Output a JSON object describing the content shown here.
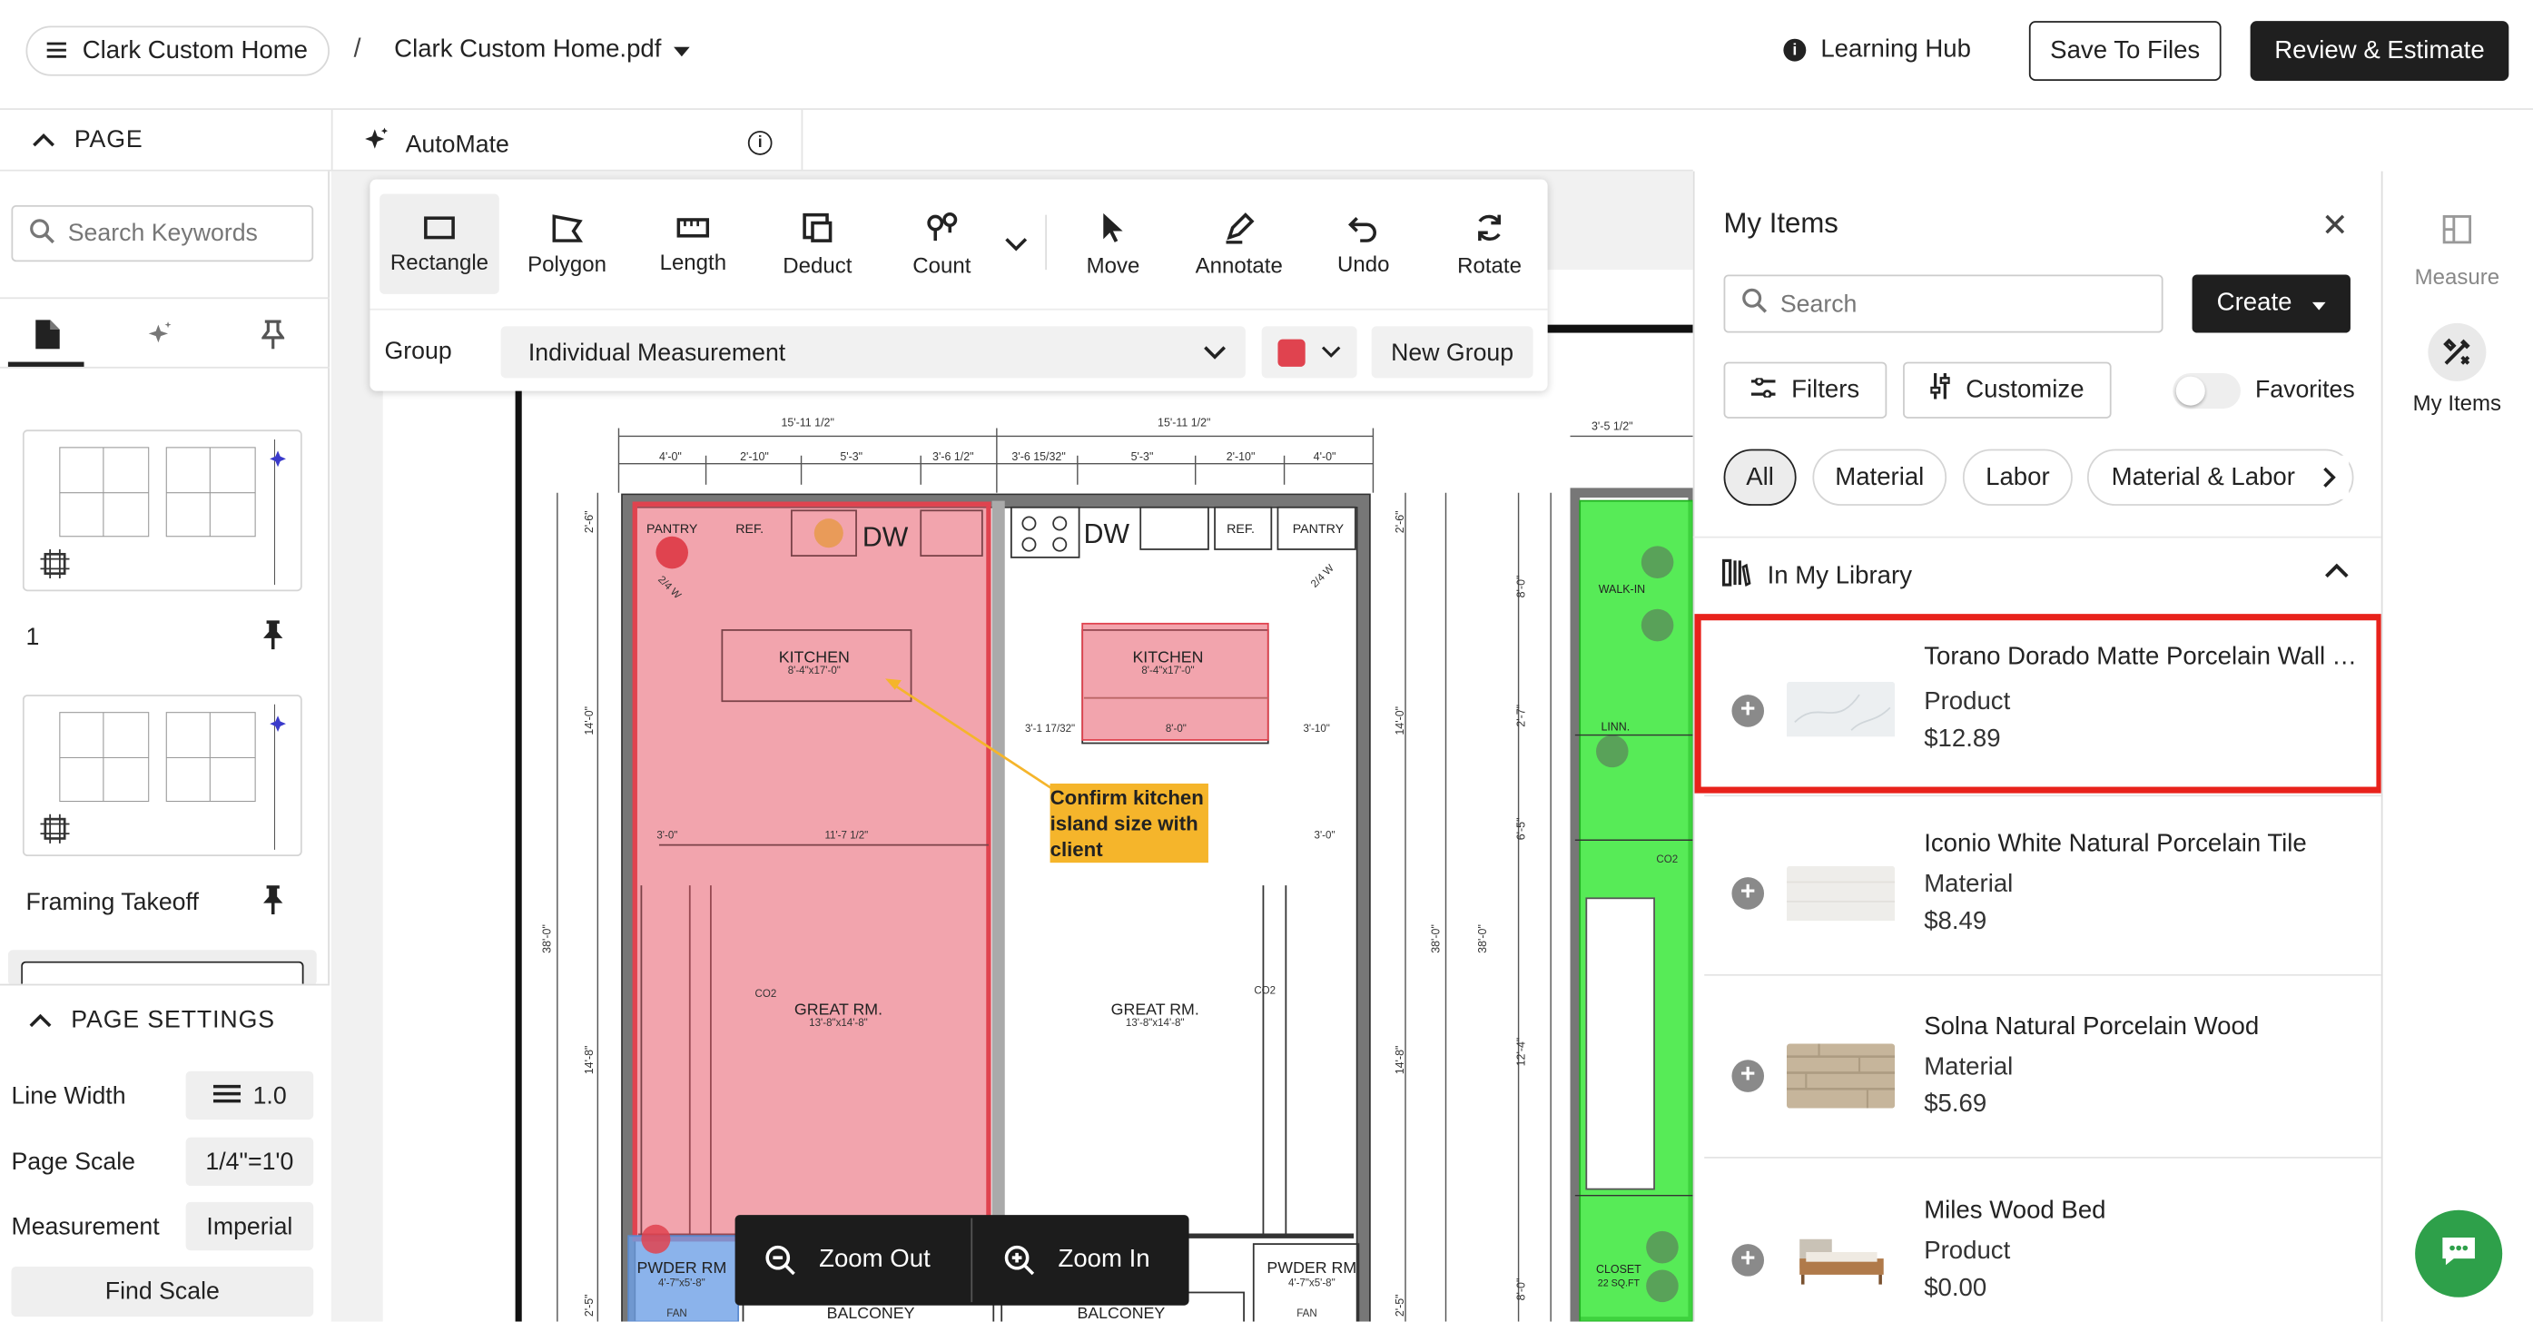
{
  "header": {
    "project_name": "Clark Custom Home",
    "separator": "/",
    "file_name": "Clark Custom Home.pdf",
    "learning_hub": "Learning Hub",
    "save_to_files": "Save To Files",
    "review_estimate": "Review & Estimate"
  },
  "subbar": {
    "page_label": "PAGE",
    "automate_label": "AutoMate"
  },
  "left_panel": {
    "search_placeholder": "Search Keywords",
    "pages": [
      {
        "label": "1"
      },
      {
        "label": "Framing Takeoff"
      }
    ],
    "settings": {
      "title": "PAGE SETTINGS",
      "line_width_label": "Line Width",
      "line_width_value": "1.0",
      "page_scale_label": "Page Scale",
      "page_scale_value": "1/4\"=1'0",
      "measurement_label": "Measurement",
      "measurement_value": "Imperial",
      "find_scale": "Find Scale"
    }
  },
  "toolbar": {
    "tools": [
      "Rectangle",
      "Polygon",
      "Length",
      "Deduct",
      "Count",
      "Move",
      "Annotate",
      "Undo",
      "Rotate"
    ],
    "group_label": "Group",
    "group_value": "Individual Measurement",
    "group_color": "#e0434f",
    "new_group": "New Group"
  },
  "blueprint": {
    "dims_top_left": [
      "15'-11 1/2\"",
      "4'-0\"",
      "2'-10\"",
      "5'-3\"",
      "3'-6 1/2\""
    ],
    "dims_top_right": [
      "15'-11 1/2\"",
      "3'-6 15/32\"",
      "5'-3\"",
      "2'-10\"",
      "4'-0\""
    ],
    "dim_far_right": "3'-5 1/2\"",
    "left_labels": [
      "2'-6\"",
      "14'-0\"",
      "38'-0\"",
      "14'-8\"",
      "2'-5\""
    ],
    "labels": {
      "pantry_l": "PANTRY",
      "ref_l": "REF.",
      "dw_l": "DW",
      "dw_r": "DW",
      "ref_r": "REF.",
      "pantry_r": "PANTRY",
      "kitchen_l": "KITCHEN",
      "kitchen_l_dim": "8'-4\"x17'-0\"",
      "kitchen_r": "KITCHEN",
      "kitchen_r_dim": "8'-4\"x17'-0\"",
      "dim_3_0a": "3'-0\"",
      "dim_11_7": "11'-7 1/2\"",
      "dim_3_0b": "3'-0\"",
      "dim_3_1": "3'-1 17/32\"",
      "dim_8_0": "8'-0\"",
      "dim_3_10": "3'-10\"",
      "great_l": "GREAT RM.",
      "great_l_dim": "13'-8\"x14'-8\"",
      "great_r": "GREAT RM.",
      "great_r_dim": "13'-8\"x14'-8\"",
      "pwder_l": "PWDER RM",
      "pwder_l_dim": "4'-7\"x5'-8\"",
      "pwder_r": "PWDER RM",
      "pwder_r_dim": "4'-7\"x5'-8\"",
      "fan_l": "FAN",
      "fan_r": "FAN",
      "balcony_l": "BALCONEY",
      "balcony_r": "BALCONEY",
      "walkin": "WALK-IN",
      "linn": "LINN.",
      "closet": "CLOSET",
      "closet_dim": "22 SQ.FT",
      "co2_a": "CO2",
      "co2_b": "CO2",
      "co2_c": "CO2",
      "w_a": "2/4 W",
      "w_b": "2/4 W",
      "right_col": [
        "2'-6\"",
        "14'-0\"",
        "38'-0\"",
        "14'-8\"",
        "2'-5\""
      ],
      "far_col": [
        "8'-0\"",
        "2'-7\"",
        "6'-5\"",
        "38'-0\"",
        "12'-4\"",
        "8'-0\""
      ]
    },
    "annotation": "Confirm kitchen island size with client"
  },
  "zoom": {
    "zoom_out": "Zoom Out",
    "zoom_in": "Zoom In"
  },
  "my_items": {
    "title": "My Items",
    "search_placeholder": "Search",
    "create": "Create",
    "filters": "Filters",
    "customize": "Customize",
    "favorites": "Favorites",
    "chips": [
      "All",
      "Material",
      "Labor",
      "Material & Labor"
    ],
    "library_title": "In My Library",
    "items": [
      {
        "name": "Torano Dorado Matte Porcelain Wall Tile",
        "type": "Product",
        "price": "$12.89"
      },
      {
        "name": "Iconio White Natural Porcelain Tile",
        "type": "Material",
        "price": "$8.49"
      },
      {
        "name": "Solna Natural Porcelain Wood",
        "type": "Material",
        "price": "$5.69"
      },
      {
        "name": "Miles Wood Bed",
        "type": "Product",
        "price": "$0.00"
      }
    ]
  },
  "far_right": {
    "measure": "Measure",
    "my_items": "My Items"
  },
  "colors": {
    "accent_dark": "#1f1f1f",
    "highlight": "#e8221b",
    "measure_red": "#e8747f",
    "measure_green": "#3ee83a",
    "measure_blue": "#7aaee8",
    "annotation_yellow": "#f5b52b",
    "chat_green": "#2ea04a"
  }
}
